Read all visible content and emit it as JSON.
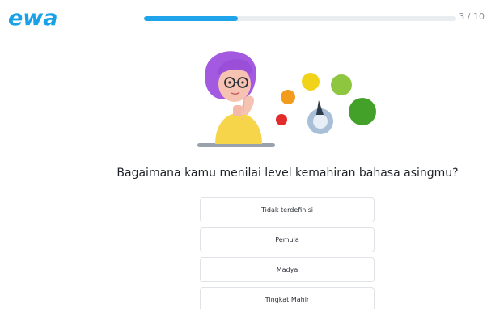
{
  "app": {
    "logo_text": "ewa",
    "brand_color": "#18a0e8",
    "progress_color": "#1fa3ea"
  },
  "progress": {
    "current": 3,
    "total": 10,
    "counter_text": "3 / 10"
  },
  "question": {
    "text": "Bagaimana kamu menilai level kemahiran bahasa asingmu?"
  },
  "options": [
    {
      "label": "Tidak terdefinisi"
    },
    {
      "label": "Pemula"
    },
    {
      "label": "Madya"
    },
    {
      "label": "Tingkat Mahir"
    }
  ],
  "illustration": {
    "description_icon": "thinking-person-with-level-dial-icon"
  }
}
